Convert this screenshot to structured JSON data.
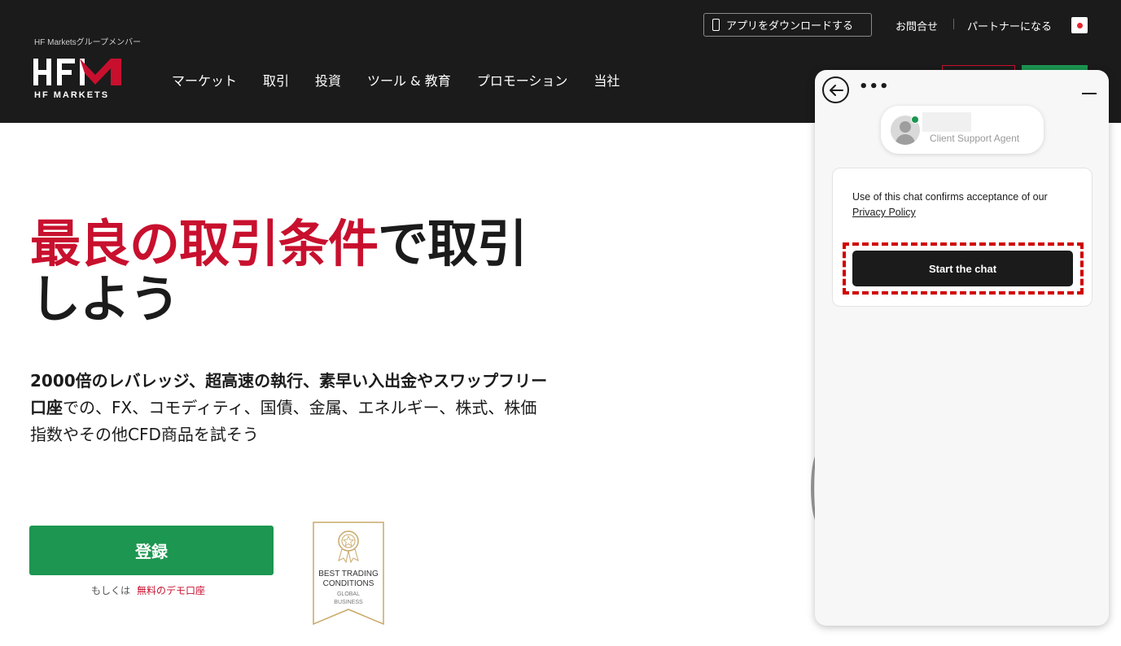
{
  "header": {
    "member_label": "HF Marketsグループメンバー",
    "logo_text": "HFM",
    "logo_sub": "HF MARKETS",
    "nav": [
      "マーケット",
      "取引",
      "投資",
      "ツール & 教育",
      "プロモーション",
      "当社"
    ],
    "app_download": "アプリをダウンロードする",
    "contact": "お問合せ",
    "partner": "パートナーになる"
  },
  "hero": {
    "title_red": "最良の取引条件",
    "title_rest": "で取引しよう",
    "desc_bold": "2000倍のレバレッジ、超高速の執行、素早い入出金やスワップフリー口座",
    "desc_rest": "での、FX、コモディティ、国債、金属、エネルギー、株式、株価指数やその他CFD商品を試そう",
    "signup_label": "登録",
    "or_label": "もしくは",
    "demo_label": "無料のデモ口座"
  },
  "badge": {
    "line1": "BEST TRADING",
    "line2": "CONDITIONS",
    "line3": "GLOBAL",
    "line4": "BUSINESS"
  },
  "chat": {
    "agent_role": "Client Support Agent",
    "consent_text": "Use of this chat confirms acceptance of our",
    "privacy_link": "Privacy Policy",
    "start_label": "Start the chat",
    "more_label": "•••"
  }
}
